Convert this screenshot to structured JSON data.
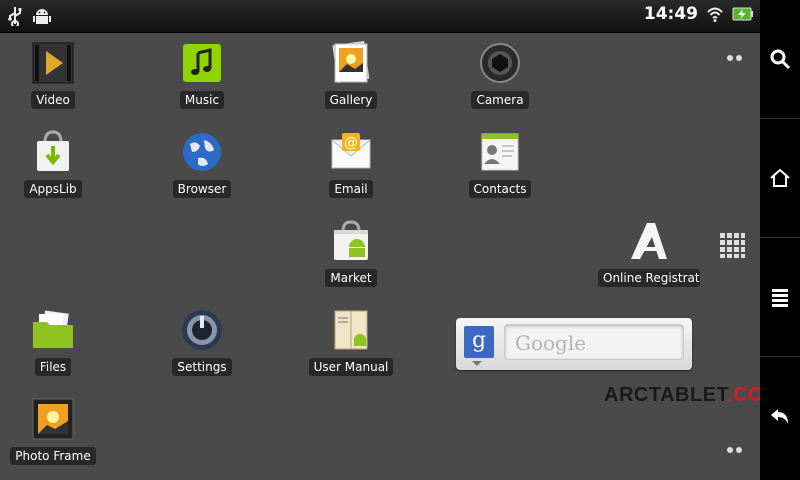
{
  "status": {
    "time": "14:49",
    "left_icons": [
      "usb-icon",
      "android-debug-icon"
    ],
    "right_icons": [
      "wifi-icon",
      "battery-charging-icon"
    ]
  },
  "apps": [
    {
      "label": "Video",
      "icon": "video-icon"
    },
    {
      "label": "Music",
      "icon": "music-icon"
    },
    {
      "label": "Gallery",
      "icon": "gallery-icon"
    },
    {
      "label": "Camera",
      "icon": "camera-icon"
    },
    {
      "label": "AppsLib",
      "icon": "appslib-icon"
    },
    {
      "label": "Browser",
      "icon": "browser-icon"
    },
    {
      "label": "Email",
      "icon": "email-icon"
    },
    {
      "label": "Contacts",
      "icon": "contacts-icon"
    },
    {
      "label": "Market",
      "icon": "market-icon"
    },
    {
      "label": "Online Registrati",
      "icon": "online-registration-icon"
    },
    {
      "label": "Files",
      "icon": "files-icon"
    },
    {
      "label": "Settings",
      "icon": "settings-icon"
    },
    {
      "label": "User Manual",
      "icon": "user-manual-icon"
    },
    {
      "label": "Photo Frame",
      "icon": "photo-frame-icon"
    }
  ],
  "google_widget": {
    "logo_letter": "g",
    "placeholder": "Google"
  },
  "navbar": {
    "buttons": [
      "search-icon",
      "home-icon",
      "menu-icon",
      "back-icon"
    ]
  },
  "watermark": {
    "brand": "ARCTABLET",
    "dot": ".",
    "suffix": "COM"
  },
  "colors": {
    "background": "#4a4a4a",
    "google_blue": "#3b68c5",
    "watermark_red": "#d81b1b",
    "battery_green": "#57b72a"
  }
}
